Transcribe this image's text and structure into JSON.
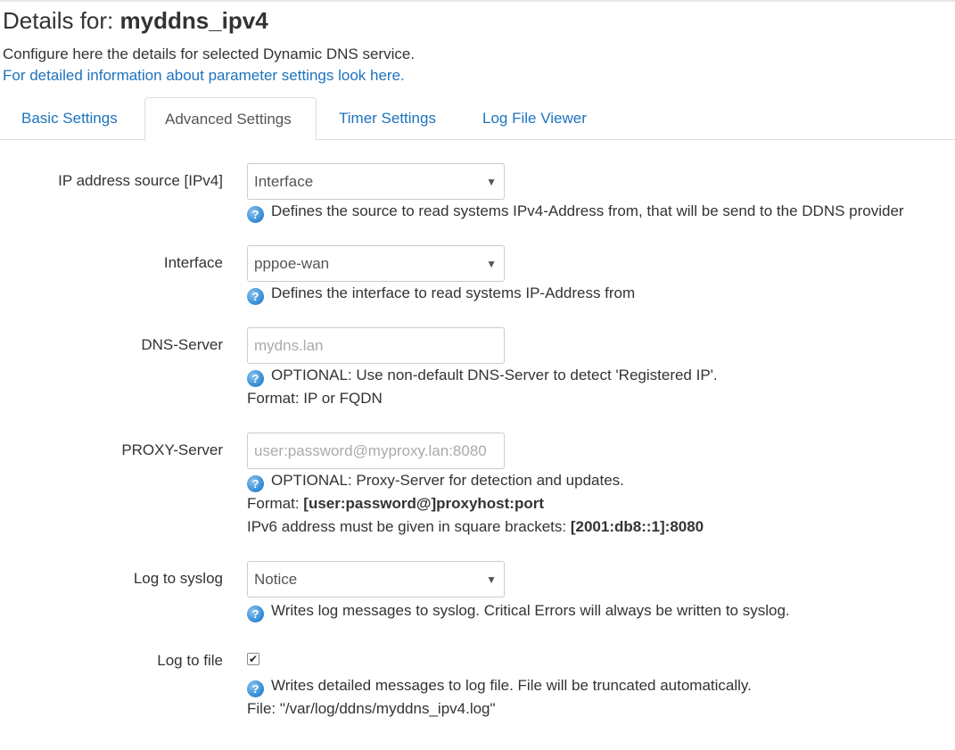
{
  "header": {
    "title_prefix": "Details for:",
    "title_name": "myddns_ipv4",
    "description": "Configure here the details for selected Dynamic DNS service.",
    "info_link": "For detailed information about parameter settings look here."
  },
  "tabs": [
    {
      "label": "Basic Settings",
      "active": false
    },
    {
      "label": "Advanced Settings",
      "active": true
    },
    {
      "label": "Timer Settings",
      "active": false
    },
    {
      "label": "Log File Viewer",
      "active": false
    }
  ],
  "fields": {
    "ip_source": {
      "label": "IP address source [IPv4]",
      "value": "Interface",
      "help": "Defines the source to read systems IPv4-Address from, that will be send to the DDNS provider"
    },
    "interface": {
      "label": "Interface",
      "value": "pppoe-wan",
      "help": "Defines the interface to read systems IP-Address from"
    },
    "dns_server": {
      "label": "DNS-Server",
      "placeholder": "mydns.lan",
      "help": "OPTIONAL: Use non-default DNS-Server to detect 'Registered IP'.",
      "format": "Format: IP or FQDN"
    },
    "proxy_server": {
      "label": "PROXY-Server",
      "placeholder": "user:password@myproxy.lan:8080",
      "help": "OPTIONAL: Proxy-Server for detection and updates.",
      "format_prefix": "Format: ",
      "format_value": "[user:password@]proxyhost:port",
      "ipv6_prefix": "IPv6 address must be given in square brackets: ",
      "ipv6_value": "[2001:db8::1]:8080"
    },
    "log_syslog": {
      "label": "Log to syslog",
      "value": "Notice",
      "help": "Writes log messages to syslog. Critical Errors will always be written to syslog."
    },
    "log_file": {
      "label": "Log to file",
      "checked": true,
      "check_mark": "✔",
      "help": "Writes detailed messages to log file. File will be truncated automatically.",
      "file": "File: \"/var/log/ddns/myddns_ipv4.log\""
    }
  },
  "icons": {
    "help": "?",
    "dropdown": "▼"
  },
  "colors": {
    "link": "#1e73be",
    "text": "#333333",
    "help_icon": "#3a8fd6"
  }
}
